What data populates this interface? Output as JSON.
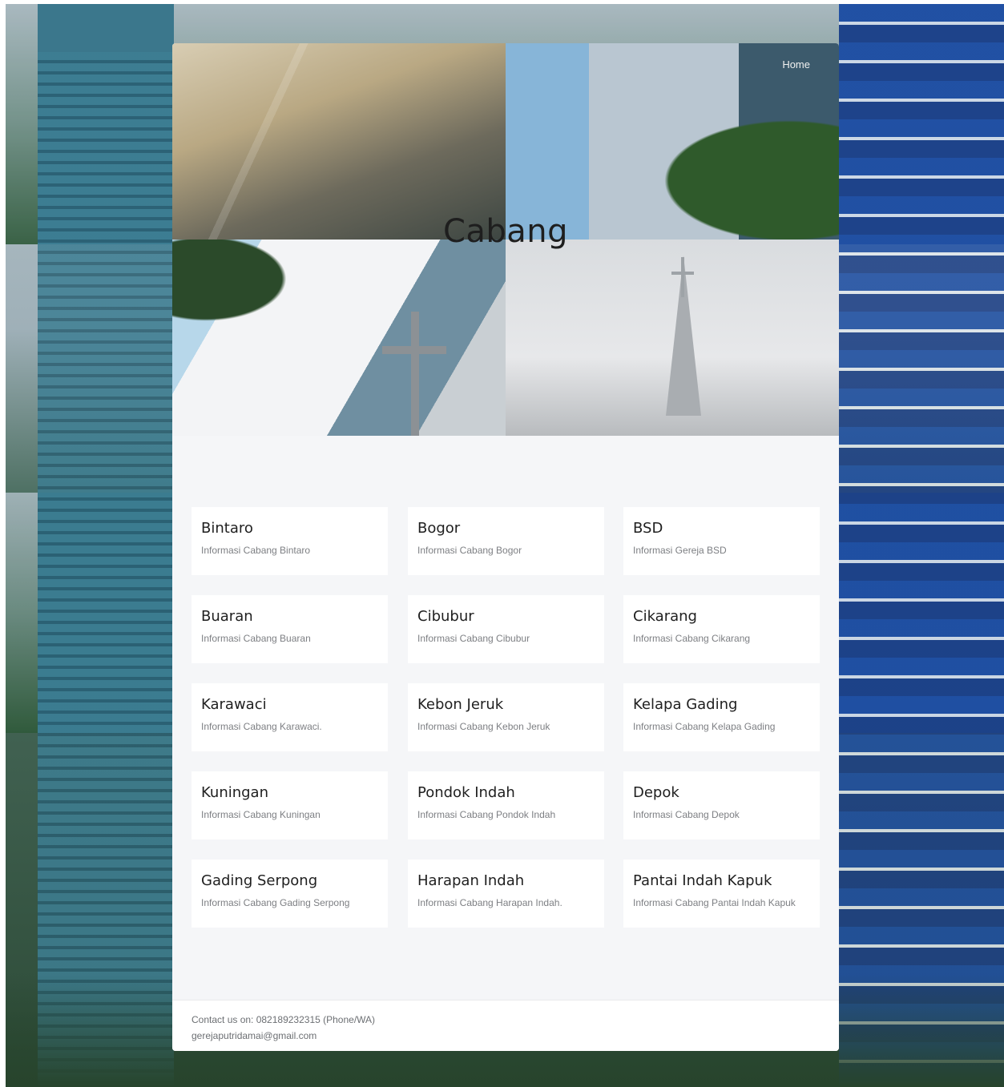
{
  "nav": {
    "home_label": "Home"
  },
  "hero": {
    "title": "Cabang"
  },
  "branches": [
    {
      "name": "Bintaro",
      "info": "Informasi Cabang Bintaro"
    },
    {
      "name": "Bogor",
      "info": "Informasi Cabang Bogor"
    },
    {
      "name": "BSD",
      "info": "Informasi Gereja BSD"
    },
    {
      "name": "Buaran",
      "info": "Informasi Cabang Buaran"
    },
    {
      "name": "Cibubur",
      "info": "Informasi Cabang Cibubur"
    },
    {
      "name": "Cikarang",
      "info": "Informasi Cabang Cikarang"
    },
    {
      "name": "Karawaci",
      "info": "Informasi Cabang Karawaci."
    },
    {
      "name": "Kebon Jeruk",
      "info": "Informasi Cabang Kebon Jeruk"
    },
    {
      "name": "Kelapa Gading",
      "info": "Informasi Cabang Kelapa Gading"
    },
    {
      "name": "Kuningan",
      "info": "Informasi Cabang Kuningan"
    },
    {
      "name": "Pondok Indah",
      "info": "Informasi Cabang Pondok Indah"
    },
    {
      "name": "Depok",
      "info": "Informasi Cabang Depok"
    },
    {
      "name": "Gading Serpong",
      "info": "Informasi Cabang Gading Serpong"
    },
    {
      "name": "Harapan Indah",
      "info": "Informasi Cabang Harapan Indah."
    },
    {
      "name": "Pantai Indah Kapuk",
      "info": "Informasi Cabang Pantai Indah Kapuk"
    }
  ],
  "footer": {
    "contact": "Contact us on: 082189232315 (Phone/WA)",
    "email": "gerejaputridamai@gmail.com"
  }
}
